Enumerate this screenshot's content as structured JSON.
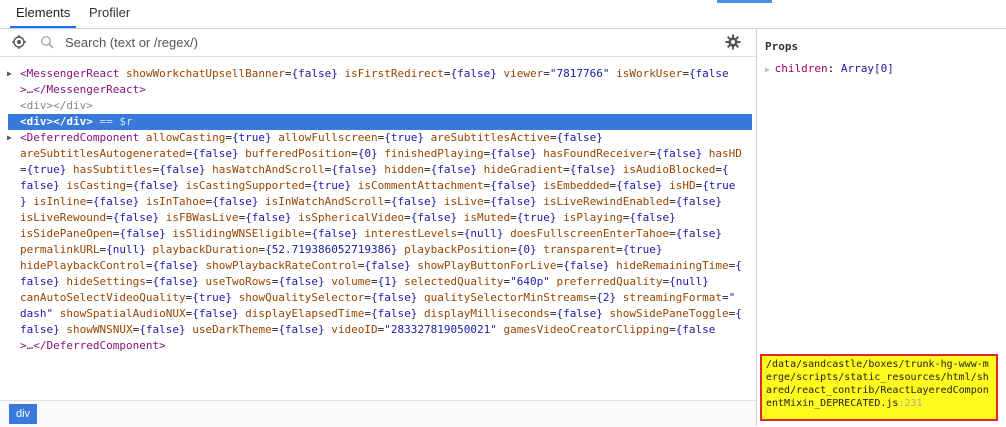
{
  "tabs": [
    {
      "label": "Elements",
      "active": true
    },
    {
      "label": "Profiler",
      "active": false
    }
  ],
  "search": {
    "placeholder": "Search (text or /regex/)"
  },
  "icons": {
    "picker": "target-icon",
    "search": "magnifier-icon",
    "settings": "gear-icon"
  },
  "colors": {
    "selection": "#3879d9",
    "tag": "#881280",
    "attr_name": "#994500",
    "attr_value": "#1a1aa6",
    "highlight_box": "#fffb1f",
    "highlight_border": "#e3262b"
  },
  "tree": {
    "messenger_line1": {
      "open": "<MessengerReact",
      "attrs": [
        {
          "n": " showWorkchatUpsellBanner",
          "v": "{false}"
        },
        {
          "n": " isFirstRedirect",
          "v": "{false}"
        },
        {
          "n": " viewer",
          "v": "\"7817766\""
        },
        {
          "n": " isWorkUser",
          "v": "{false"
        }
      ]
    },
    "messenger_line2": {
      "dots": ">…",
      "close": "</MessengerReact>"
    },
    "plain_div": "<div></div>",
    "selected_div": {
      "tag": "<div></div>",
      "suffix": " == $r"
    },
    "deferred_lines": [
      [
        [
          "t",
          "<DeferredComponent"
        ],
        [
          "n",
          " allowCasting"
        ],
        [
          "e",
          "="
        ],
        [
          "v",
          "{true}"
        ],
        [
          "n",
          " allowFullscreen"
        ],
        [
          "e",
          "="
        ],
        [
          "v",
          "{true}"
        ],
        [
          "n",
          " areSubtitlesActive"
        ],
        [
          "e",
          "="
        ],
        [
          "v",
          "{false}"
        ]
      ],
      [
        [
          "n",
          "areSubtitlesAutogenerated"
        ],
        [
          "e",
          "="
        ],
        [
          "v",
          "{false}"
        ],
        [
          "n",
          " bufferedPosition"
        ],
        [
          "e",
          "="
        ],
        [
          "v",
          "{0}"
        ],
        [
          "n",
          " finishedPlaying"
        ],
        [
          "e",
          "="
        ],
        [
          "v",
          "{false}"
        ],
        [
          "n",
          " hasFoundReceiver"
        ],
        [
          "e",
          "="
        ],
        [
          "v",
          "{false}"
        ],
        [
          "n",
          " hasHD"
        ]
      ],
      [
        [
          "e",
          "="
        ],
        [
          "v",
          "{true}"
        ],
        [
          "n",
          " hasSubtitles"
        ],
        [
          "e",
          "="
        ],
        [
          "v",
          "{false}"
        ],
        [
          "n",
          " hasWatchAndScroll"
        ],
        [
          "e",
          "="
        ],
        [
          "v",
          "{false}"
        ],
        [
          "n",
          " hidden"
        ],
        [
          "e",
          "="
        ],
        [
          "v",
          "{false}"
        ],
        [
          "n",
          " hideGradient"
        ],
        [
          "e",
          "="
        ],
        [
          "v",
          "{false}"
        ],
        [
          "n",
          " isAudioBlocked"
        ],
        [
          "e",
          "="
        ],
        [
          "v",
          "{"
        ]
      ],
      [
        [
          "v",
          "false}"
        ],
        [
          "n",
          " isCasting"
        ],
        [
          "e",
          "="
        ],
        [
          "v",
          "{false}"
        ],
        [
          "n",
          " isCastingSupported"
        ],
        [
          "e",
          "="
        ],
        [
          "v",
          "{true}"
        ],
        [
          "n",
          " isCommentAttachment"
        ],
        [
          "e",
          "="
        ],
        [
          "v",
          "{false}"
        ],
        [
          "n",
          " isEmbedded"
        ],
        [
          "e",
          "="
        ],
        [
          "v",
          "{false}"
        ],
        [
          "n",
          " isHD"
        ],
        [
          "e",
          "="
        ],
        [
          "v",
          "{true"
        ]
      ],
      [
        [
          "v",
          "}"
        ],
        [
          "n",
          " isInline"
        ],
        [
          "e",
          "="
        ],
        [
          "v",
          "{false}"
        ],
        [
          "n",
          " isInTahoe"
        ],
        [
          "e",
          "="
        ],
        [
          "v",
          "{false}"
        ],
        [
          "n",
          " isInWatchAndScroll"
        ],
        [
          "e",
          "="
        ],
        [
          "v",
          "{false}"
        ],
        [
          "n",
          " isLive"
        ],
        [
          "e",
          "="
        ],
        [
          "v",
          "{false}"
        ],
        [
          "n",
          " isLiveRewindEnabled"
        ],
        [
          "e",
          "="
        ],
        [
          "v",
          "{false}"
        ]
      ],
      [
        [
          "n",
          "isLiveRewound"
        ],
        [
          "e",
          "="
        ],
        [
          "v",
          "{false}"
        ],
        [
          "n",
          " isFBWasLive"
        ],
        [
          "e",
          "="
        ],
        [
          "v",
          "{false}"
        ],
        [
          "n",
          " isSphericalVideo"
        ],
        [
          "e",
          "="
        ],
        [
          "v",
          "{false}"
        ],
        [
          "n",
          " isMuted"
        ],
        [
          "e",
          "="
        ],
        [
          "v",
          "{true}"
        ],
        [
          "n",
          " isPlaying"
        ],
        [
          "e",
          "="
        ],
        [
          "v",
          "{false}"
        ]
      ],
      [
        [
          "n",
          "isSidePaneOpen"
        ],
        [
          "e",
          "="
        ],
        [
          "v",
          "{false}"
        ],
        [
          "n",
          " isSlidingWNSEligible"
        ],
        [
          "e",
          "="
        ],
        [
          "v",
          "{false}"
        ],
        [
          "n",
          " interestLevels"
        ],
        [
          "e",
          "="
        ],
        [
          "v",
          "{null}"
        ],
        [
          "n",
          " doesFullscreenEnterTahoe"
        ],
        [
          "e",
          "="
        ],
        [
          "v",
          "{false}"
        ]
      ],
      [
        [
          "n",
          "permalinkURL"
        ],
        [
          "e",
          "="
        ],
        [
          "v",
          "{null}"
        ],
        [
          "n",
          " playbackDuration"
        ],
        [
          "e",
          "="
        ],
        [
          "v",
          "{52.719386052719386}"
        ],
        [
          "n",
          " playbackPosition"
        ],
        [
          "e",
          "="
        ],
        [
          "v",
          "{0}"
        ],
        [
          "n",
          " transparent"
        ],
        [
          "e",
          "="
        ],
        [
          "v",
          "{true}"
        ]
      ],
      [
        [
          "n",
          "hidePlaybackControl"
        ],
        [
          "e",
          "="
        ],
        [
          "v",
          "{false}"
        ],
        [
          "n",
          " showPlaybackRateControl"
        ],
        [
          "e",
          "="
        ],
        [
          "v",
          "{false}"
        ],
        [
          "n",
          " showPlayButtonForLive"
        ],
        [
          "e",
          "="
        ],
        [
          "v",
          "{false}"
        ],
        [
          "n",
          " hideRemainingTime"
        ],
        [
          "e",
          "="
        ],
        [
          "v",
          "{"
        ]
      ],
      [
        [
          "v",
          "false}"
        ],
        [
          "n",
          " hideSettings"
        ],
        [
          "e",
          "="
        ],
        [
          "v",
          "{false}"
        ],
        [
          "n",
          " useTwoRows"
        ],
        [
          "e",
          "="
        ],
        [
          "v",
          "{false}"
        ],
        [
          "n",
          " volume"
        ],
        [
          "e",
          "="
        ],
        [
          "v",
          "{1}"
        ],
        [
          "n",
          " selectedQuality"
        ],
        [
          "e",
          "="
        ],
        [
          "v",
          "\"640p\""
        ],
        [
          "n",
          " preferredQuality"
        ],
        [
          "e",
          "="
        ],
        [
          "v",
          "{null}"
        ]
      ],
      [
        [
          "n",
          "canAutoSelectVideoQuality"
        ],
        [
          "e",
          "="
        ],
        [
          "v",
          "{true}"
        ],
        [
          "n",
          " showQualitySelector"
        ],
        [
          "e",
          "="
        ],
        [
          "v",
          "{false}"
        ],
        [
          "n",
          " qualitySelectorMinStreams"
        ],
        [
          "e",
          "="
        ],
        [
          "v",
          "{2}"
        ],
        [
          "n",
          " streamingFormat"
        ],
        [
          "e",
          "="
        ],
        [
          "v",
          "\""
        ]
      ],
      [
        [
          "v",
          "dash\""
        ],
        [
          "n",
          " showSpatialAudioNUX"
        ],
        [
          "e",
          "="
        ],
        [
          "v",
          "{false}"
        ],
        [
          "n",
          " displayElapsedTime"
        ],
        [
          "e",
          "="
        ],
        [
          "v",
          "{false}"
        ],
        [
          "n",
          " displayMilliseconds"
        ],
        [
          "e",
          "="
        ],
        [
          "v",
          "{false}"
        ],
        [
          "n",
          " showSidePaneToggle"
        ],
        [
          "e",
          "="
        ],
        [
          "v",
          "{"
        ]
      ],
      [
        [
          "v",
          "false}"
        ],
        [
          "n",
          " showWNSNUX"
        ],
        [
          "e",
          "="
        ],
        [
          "v",
          "{false}"
        ],
        [
          "n",
          " useDarkTheme"
        ],
        [
          "e",
          "="
        ],
        [
          "v",
          "{false}"
        ],
        [
          "n",
          " videoID"
        ],
        [
          "e",
          "="
        ],
        [
          "v",
          "\"283327819050021\""
        ],
        [
          "n",
          " gamesVideoCreatorClipping"
        ],
        [
          "e",
          "="
        ],
        [
          "v",
          "{false"
        ]
      ],
      [
        [
          "t",
          ">…</DeferredComponent>"
        ]
      ]
    ]
  },
  "props": {
    "title": "Props",
    "row": {
      "key": "children",
      "colon": ": ",
      "value": "Array[0]"
    }
  },
  "source": {
    "path": "/data/sandcastle/boxes/trunk-hg-www-merge/scripts/static_resources/html/shared/react_contrib/ReactLayeredComponentMixin_DEPRECATED.js",
    "line_suffix": ":231"
  },
  "breadcrumb": {
    "label": "div"
  }
}
